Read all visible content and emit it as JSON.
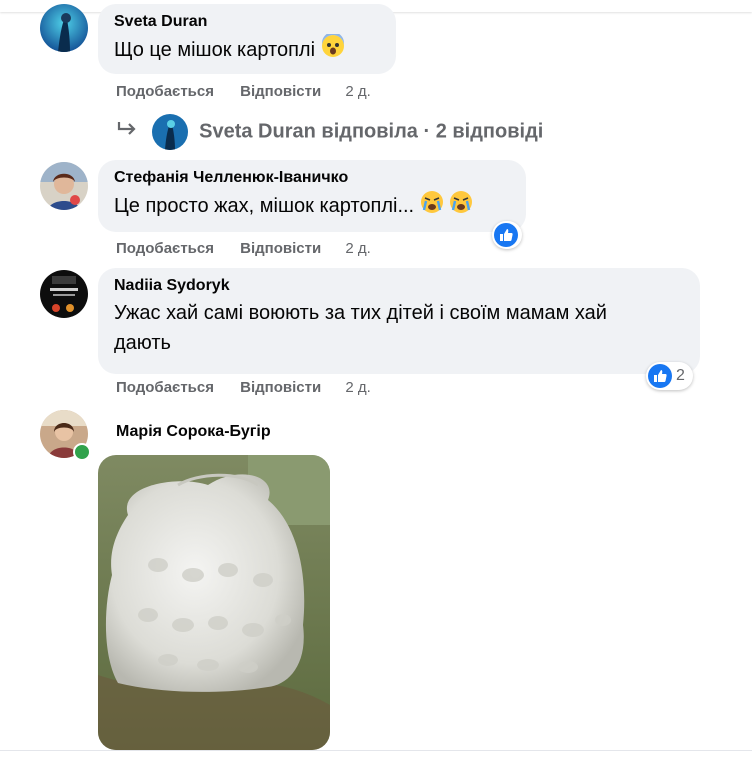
{
  "comments": [
    {
      "author": "Sveta Duran",
      "text": "Що це мішок картоплі",
      "emoji_icons": [
        "fearful-face-icon"
      ],
      "actions": {
        "like": "Подобається",
        "reply": "Відповісти",
        "time": "2 д."
      },
      "replies_summary": {
        "author": "Sveta Duran",
        "text": "відповіла · 2 відповіді"
      }
    },
    {
      "author": "Стефанія Челленюк-Іваничко",
      "text": "Це просто жах, мішок картоплі...",
      "emoji_icons": [
        "crying-face-icon",
        "crying-face-icon"
      ],
      "reaction": {
        "icon": "like-icon",
        "count": ""
      },
      "actions": {
        "like": "Подобається",
        "reply": "Відповісти",
        "time": "2 д."
      }
    },
    {
      "author": "Nadiia Sydoryk",
      "text_line1": "Ужас хай самі воюють за тих дітей і своїм мамам хай",
      "text_line2": "дають",
      "reaction": {
        "icon": "like-icon",
        "count": "2"
      },
      "actions": {
        "like": "Подобається",
        "reply": "Відповісти",
        "time": "2 д."
      }
    },
    {
      "author": "Марія Сорока-Бугір",
      "online": true,
      "attachment": {
        "type": "photo",
        "icon": "white-sack-photo"
      }
    }
  ],
  "colors": {
    "bubble": "#f0f2f5",
    "secondary_text": "#65676b",
    "like_blue": "#1877f2",
    "online_green": "#31a24c"
  }
}
